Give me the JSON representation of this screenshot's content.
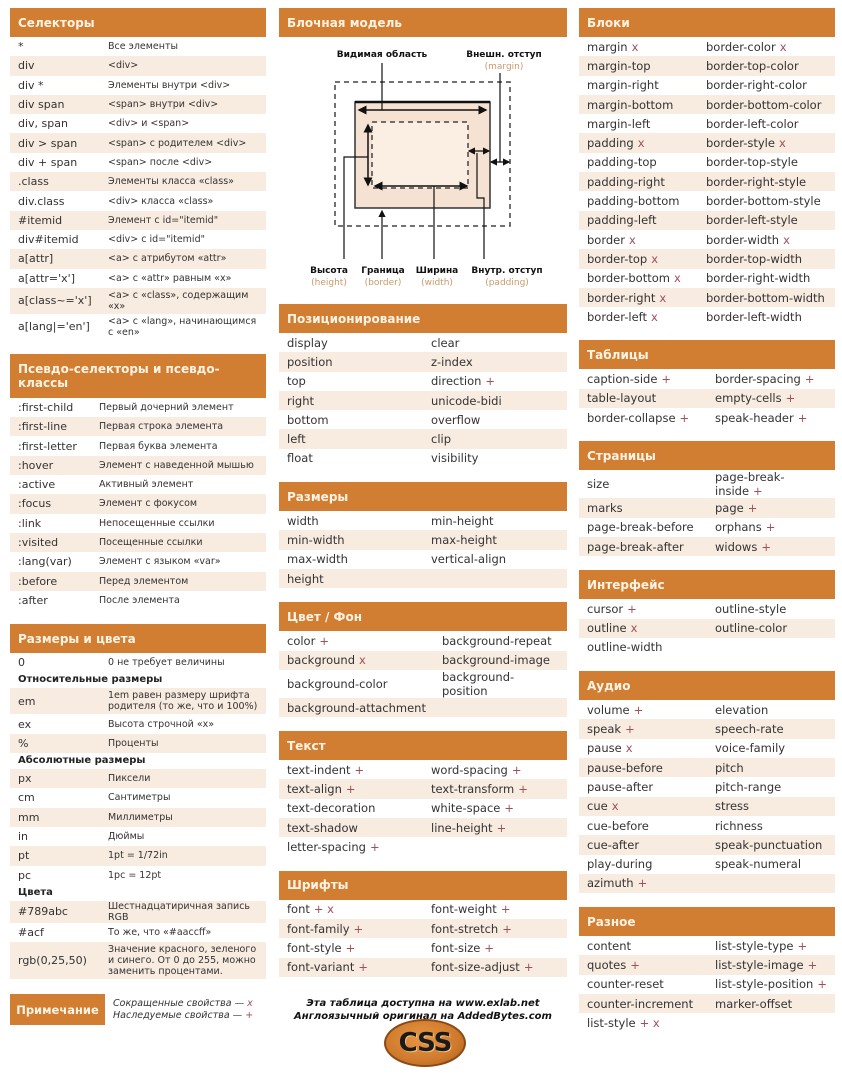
{
  "colors": {
    "accent": "#d17e33",
    "stripe": "#f8ebe0",
    "marker": "#a0505a"
  },
  "selectors": {
    "title": "Селекторы",
    "rows": [
      [
        "*",
        "Все элементы"
      ],
      [
        "div",
        "<div>"
      ],
      [
        "div *",
        "Элементы внутри <div>"
      ],
      [
        "div span",
        "<span> внутри <div>"
      ],
      [
        "div, span",
        "<div> и <span>"
      ],
      [
        "div > span",
        "<span> с родителем <div>"
      ],
      [
        "div + span",
        "<span> после <div>"
      ],
      [
        ".class",
        "Элементы класса «class»"
      ],
      [
        "div.class",
        "<div> класса «class»"
      ],
      [
        "#itemid",
        "Элемент с id=\"itemid\""
      ],
      [
        "div#itemid",
        "<div> с id=\"itemid\""
      ],
      [
        "a[attr]",
        "<a> с атрибутом «attr»"
      ],
      [
        "a[attr='x']",
        "<a> с «attr» равным «x»"
      ],
      [
        "a[class~='x']",
        "<a> с «class», содержащим «x»"
      ],
      [
        "a[lang|='en']",
        "<a> с «lang», начинающимся с «en»"
      ]
    ]
  },
  "pseudo": {
    "title": "Псевдо-селекторы и псевдо-классы",
    "rows": [
      [
        ":first-child",
        "Первый дочерний элемент"
      ],
      [
        ":first-line",
        "Первая строка элемента"
      ],
      [
        ":first-letter",
        "Первая буква элемента"
      ],
      [
        ":hover",
        "Элемент с наведенной мышью"
      ],
      [
        ":active",
        "Активный элемент"
      ],
      [
        ":focus",
        "Элемент с фокусом"
      ],
      [
        ":link",
        "Непосещенные ссылки"
      ],
      [
        ":visited",
        "Посещенные ссылки"
      ],
      [
        ":lang(var)",
        "Элемент с языком «var»"
      ],
      [
        ":before",
        "Перед элементом"
      ],
      [
        ":after",
        "После элемента"
      ]
    ]
  },
  "units": {
    "title": "Размеры и цвета",
    "zero": [
      "0",
      "0 не требует величины"
    ],
    "relative_label": "Относительные размеры",
    "relative": [
      [
        "em",
        "1em равен размеру шрифта родителя (то же, что и 100%)"
      ],
      [
        "ex",
        "Высота строчной «x»"
      ],
      [
        "%",
        "Проценты"
      ]
    ],
    "absolute_label": "Абсолютные размеры",
    "absolute": [
      [
        "px",
        "Пиксели"
      ],
      [
        "cm",
        "Сантиметры"
      ],
      [
        "mm",
        "Миллиметры"
      ],
      [
        "in",
        "Дюймы"
      ],
      [
        "pt",
        "1pt = 1/72in"
      ],
      [
        "pc",
        "1pc = 12pt"
      ]
    ],
    "colors_label": "Цвета",
    "colors": [
      [
        "#789abc",
        "Шестнадцатиричная запись RGB"
      ],
      [
        "#acf",
        "То же, что «#aaccff»"
      ],
      [
        "rgb(0,25,50)",
        "Значение красного, зеленого и синего. От 0 до 255, можно заменить процентами."
      ]
    ]
  },
  "note": {
    "title": "Примечание",
    "shorthand": "Сокращенные свойства —",
    "shorthand_mark": "x",
    "inherited": "Наследуемые свойства —",
    "inherited_mark": "+"
  },
  "boxmodel": {
    "title": "Блочная модель",
    "visible_area": "Видимая область",
    "margin": "Внешн. отступ",
    "margin_en": "(margin)",
    "height": "Высота",
    "height_en": "(height)",
    "border": "Граница",
    "border_en": "(border)",
    "width": "Ширина",
    "width_en": "(width)",
    "padding": "Внутр. отступ",
    "padding_en": "(padding)"
  },
  "positioning": {
    "title": "Позиционирование",
    "rows": [
      [
        [
          "display",
          ""
        ],
        [
          "clear",
          ""
        ]
      ],
      [
        [
          "position",
          ""
        ],
        [
          "z-index",
          ""
        ]
      ],
      [
        [
          "top",
          ""
        ],
        [
          "direction",
          "+"
        ]
      ],
      [
        [
          "right",
          ""
        ],
        [
          "unicode-bidi",
          ""
        ]
      ],
      [
        [
          "bottom",
          ""
        ],
        [
          "overflow",
          ""
        ]
      ],
      [
        [
          "left",
          ""
        ],
        [
          "clip",
          ""
        ]
      ],
      [
        [
          "float",
          ""
        ],
        [
          "visibility",
          ""
        ]
      ]
    ]
  },
  "dimensions": {
    "title": "Размеры",
    "rows": [
      [
        [
          "width",
          ""
        ],
        [
          "min-height",
          ""
        ]
      ],
      [
        [
          "min-width",
          ""
        ],
        [
          "max-height",
          ""
        ]
      ],
      [
        [
          "max-width",
          ""
        ],
        [
          "vertical-align",
          ""
        ]
      ],
      [
        [
          "height",
          ""
        ],
        [
          "",
          ""
        ]
      ]
    ]
  },
  "colorbg": {
    "title": "Цвет / Фон",
    "rows": [
      [
        [
          "color",
          "+"
        ],
        [
          "background-repeat",
          ""
        ]
      ],
      [
        [
          "background",
          "x"
        ],
        [
          "background-image",
          ""
        ]
      ],
      [
        [
          "background-color",
          ""
        ],
        [
          "background-position",
          ""
        ]
      ],
      [
        [
          "background-attachment",
          ""
        ],
        [
          "",
          ""
        ]
      ]
    ]
  },
  "text": {
    "title": "Текст",
    "rows": [
      [
        [
          "text-indent",
          "+"
        ],
        [
          "word-spacing",
          "+"
        ]
      ],
      [
        [
          "text-align",
          "+"
        ],
        [
          "text-transform",
          "+"
        ]
      ],
      [
        [
          "text-decoration",
          ""
        ],
        [
          "white-space",
          "+"
        ]
      ],
      [
        [
          "text-shadow",
          ""
        ],
        [
          "line-height",
          "+"
        ]
      ],
      [
        [
          "letter-spacing",
          "+"
        ],
        [
          "",
          ""
        ]
      ]
    ]
  },
  "fonts": {
    "title": "Шрифты",
    "rows": [
      [
        [
          "font",
          "+ x"
        ],
        [
          "font-weight",
          "+"
        ]
      ],
      [
        [
          "font-family",
          "+"
        ],
        [
          "font-stretch",
          "+"
        ]
      ],
      [
        [
          "font-style",
          "+"
        ],
        [
          "font-size",
          "+"
        ]
      ],
      [
        [
          "font-variant",
          "+"
        ],
        [
          "font-size-adjust",
          "+"
        ]
      ]
    ]
  },
  "footer": {
    "line1": "Эта таблица доступна на www.exlab.net",
    "line2": "Англоязычный оригинал на AddedBytes.com",
    "logo": "CSS"
  },
  "blocks": {
    "title": "Блоки",
    "rows": [
      [
        [
          "margin",
          "x"
        ],
        [
          "border-color",
          "x"
        ]
      ],
      [
        [
          "margin-top",
          ""
        ],
        [
          "border-top-color",
          ""
        ]
      ],
      [
        [
          "margin-right",
          ""
        ],
        [
          "border-right-color",
          ""
        ]
      ],
      [
        [
          "margin-bottom",
          ""
        ],
        [
          "border-bottom-color",
          ""
        ]
      ],
      [
        [
          "margin-left",
          ""
        ],
        [
          "border-left-color",
          ""
        ]
      ],
      [
        [
          "padding",
          "x"
        ],
        [
          "border-style",
          "x"
        ]
      ],
      [
        [
          "padding-top",
          ""
        ],
        [
          "border-top-style",
          ""
        ]
      ],
      [
        [
          "padding-right",
          ""
        ],
        [
          "border-right-style",
          ""
        ]
      ],
      [
        [
          "padding-bottom",
          ""
        ],
        [
          "border-bottom-style",
          ""
        ]
      ],
      [
        [
          "padding-left",
          ""
        ],
        [
          "border-left-style",
          ""
        ]
      ],
      [
        [
          "border",
          "x"
        ],
        [
          "border-width",
          "x"
        ]
      ],
      [
        [
          "border-top",
          "x"
        ],
        [
          "border-top-width",
          ""
        ]
      ],
      [
        [
          "border-bottom",
          "x"
        ],
        [
          "border-right-width",
          ""
        ]
      ],
      [
        [
          "border-right",
          "x"
        ],
        [
          "border-bottom-width",
          ""
        ]
      ],
      [
        [
          "border-left",
          "x"
        ],
        [
          "border-left-width",
          ""
        ]
      ]
    ]
  },
  "tables": {
    "title": "Таблицы",
    "rows": [
      [
        [
          "caption-side",
          "+"
        ],
        [
          "border-spacing",
          "+"
        ]
      ],
      [
        [
          "table-layout",
          ""
        ],
        [
          "empty-cells",
          "+"
        ]
      ],
      [
        [
          "border-collapse",
          "+"
        ],
        [
          "speak-header",
          "+"
        ]
      ]
    ]
  },
  "pages": {
    "title": "Страницы",
    "rows": [
      [
        [
          "size",
          ""
        ],
        [
          "page-break-inside",
          "+"
        ]
      ],
      [
        [
          "marks",
          ""
        ],
        [
          "page",
          "+"
        ]
      ],
      [
        [
          "page-break-before",
          ""
        ],
        [
          "orphans",
          "+"
        ]
      ],
      [
        [
          "page-break-after",
          ""
        ],
        [
          "widows",
          "+"
        ]
      ]
    ]
  },
  "ui": {
    "title": "Интерфейс",
    "rows": [
      [
        [
          "cursor",
          "+"
        ],
        [
          "outline-style",
          ""
        ]
      ],
      [
        [
          "outline",
          "x"
        ],
        [
          "outline-color",
          ""
        ]
      ],
      [
        [
          "outline-width",
          ""
        ],
        [
          "",
          ""
        ]
      ]
    ]
  },
  "audio": {
    "title": "Аудио",
    "rows": [
      [
        [
          "volume",
          "+"
        ],
        [
          "elevation",
          ""
        ]
      ],
      [
        [
          "speak",
          "+"
        ],
        [
          "speech-rate",
          ""
        ]
      ],
      [
        [
          "pause",
          "x"
        ],
        [
          "voice-family",
          ""
        ]
      ],
      [
        [
          "pause-before",
          ""
        ],
        [
          "pitch",
          ""
        ]
      ],
      [
        [
          "pause-after",
          ""
        ],
        [
          "pitch-range",
          ""
        ]
      ],
      [
        [
          "cue",
          "x"
        ],
        [
          "stress",
          ""
        ]
      ],
      [
        [
          "cue-before",
          ""
        ],
        [
          "richness",
          ""
        ]
      ],
      [
        [
          "cue-after",
          ""
        ],
        [
          "speak-punctuation",
          ""
        ]
      ],
      [
        [
          "play-during",
          ""
        ],
        [
          "speak-numeral",
          ""
        ]
      ],
      [
        [
          "azimuth",
          "+"
        ],
        [
          "",
          ""
        ]
      ]
    ]
  },
  "misc": {
    "title": "Разное",
    "rows": [
      [
        [
          "content",
          ""
        ],
        [
          "list-style-type",
          "+"
        ]
      ],
      [
        [
          "quotes",
          "+"
        ],
        [
          "list-style-image",
          "+"
        ]
      ],
      [
        [
          "counter-reset",
          ""
        ],
        [
          "list-style-position",
          "+"
        ]
      ],
      [
        [
          "counter-increment",
          ""
        ],
        [
          "marker-offset",
          ""
        ]
      ],
      [
        [
          "list-style",
          "+ x"
        ],
        [
          "",
          ""
        ]
      ]
    ]
  }
}
